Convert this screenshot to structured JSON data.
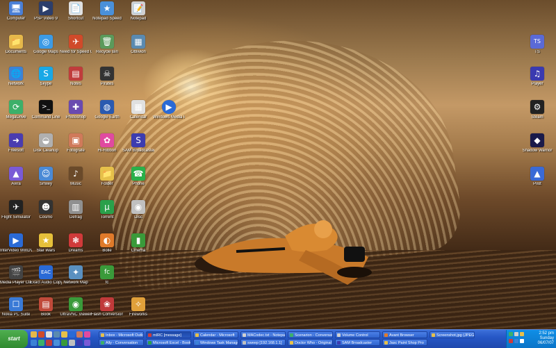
{
  "desktop": {
    "icons": [
      {
        "label": "Computer",
        "glyph": "🖥",
        "color": "#4a7fd6"
      },
      {
        "label": "PSP Video 9",
        "glyph": "▶",
        "color": "#2c3e6b"
      },
      {
        "label": "Shortcut",
        "glyph": "📄",
        "color": "#e0e0e0"
      },
      {
        "label": "Notepad Speed",
        "glyph": "★",
        "color": "#4a90d9"
      },
      {
        "label": "Notepad",
        "glyph": "📝",
        "color": "#d0d0d0"
      },
      {
        "label": "Documents",
        "glyph": "📁",
        "color": "#e6b84a"
      },
      {
        "label": "Google Maps",
        "glyph": "◎",
        "color": "#3c9be6"
      },
      {
        "label": "Need for Speed Underground",
        "glyph": "✈",
        "color": "#d04a2a"
      },
      {
        "label": "Recycle Bin",
        "glyph": "🗑",
        "color": "#5b9a5b"
      },
      {
        "label": "Oblivion",
        "glyph": "▦",
        "color": "#5a8ab0"
      },
      {
        "label": "Network",
        "glyph": "🌐",
        "color": "#3c82d6"
      },
      {
        "label": "Skype",
        "glyph": "S",
        "color": "#19a8e6"
      },
      {
        "label": "Notes",
        "glyph": "▤",
        "color": "#c03c3c"
      },
      {
        "label": "Pirates",
        "glyph": "☠",
        "color": "#333333"
      },
      {
        "label": "MegaDrive",
        "glyph": "⟳",
        "color": "#3cb06a"
      },
      {
        "label": "Command Line",
        "glyph": ">_",
        "color": "#111111"
      },
      {
        "label": "Photoshop",
        "glyph": "✚",
        "color": "#6a4ab0"
      },
      {
        "label": "Google Earth",
        "glyph": "◍",
        "color": "#2a5ab0"
      },
      {
        "label": "Calendar",
        "glyph": "▦",
        "color": "#e0e0e0"
      },
      {
        "label": "Windows Media Player",
        "glyph": "▶",
        "color": "#2a6ad6"
      },
      {
        "label": "Freesoft",
        "glyph": "➜",
        "color": "#4a3cb0"
      },
      {
        "label": "Disk Cleanup",
        "glyph": "◒",
        "color": "#b0b0b0"
      },
      {
        "label": "Fotografe",
        "glyph": "▣",
        "color": "#d07a5a"
      },
      {
        "label": "Hi-Ribbon",
        "glyph": "✿",
        "color": "#e04aa0"
      },
      {
        "label": "SAM Broadcaster",
        "glyph": "S",
        "color": "#3c3cb0"
      },
      {
        "label": "Avira",
        "glyph": "▲",
        "color": "#7a5ad6"
      },
      {
        "label": "Smiley",
        "glyph": "☺",
        "color": "#4a8ad6"
      },
      {
        "label": "Music",
        "glyph": "♪",
        "color": "#6a4a2a"
      },
      {
        "label": "Folder",
        "glyph": "📁",
        "color": "#e6c04a"
      },
      {
        "label": "Phone",
        "glyph": "☎",
        "color": "#2ab04a"
      },
      {
        "label": "Flight Simulator",
        "glyph": "✈",
        "color": "#222222"
      },
      {
        "label": "Cosmo",
        "glyph": "☻",
        "color": "#333333"
      },
      {
        "label": "Defrag",
        "glyph": "▥",
        "color": "#909090"
      },
      {
        "label": "Torrent",
        "glyph": "µ",
        "color": "#2aa04a"
      },
      {
        "label": "Disc",
        "glyph": "◉",
        "color": "#c0c0c0"
      },
      {
        "label": "InterVideo WinDVD",
        "glyph": "▶",
        "color": "#2a6ad6"
      },
      {
        "label": "Star Wars",
        "glyph": "★",
        "color": "#e6c03a"
      },
      {
        "label": "Dreams",
        "glyph": "❃",
        "color": "#d03a3a"
      },
      {
        "label": "Bolle",
        "glyph": "◐",
        "color": "#e07a2a"
      },
      {
        "label": "Cinema",
        "glyph": "▮",
        "color": "#3a9a3a"
      },
      {
        "label": "Media Player Classic",
        "glyph": "🎬",
        "color": "#444444"
      },
      {
        "label": "Exact Audio Copy",
        "glyph": "EAC",
        "color": "#2a6ad6"
      },
      {
        "label": "Network Map",
        "glyph": "✦",
        "color": "#5a90c0"
      },
      {
        "label": "fc",
        "glyph": "fc",
        "color": "#3a9a3a"
      },
      {
        "label": "Nokia PC Suite",
        "glyph": "☐",
        "color": "#3a7ad6"
      },
      {
        "label": "Book",
        "glyph": "▤",
        "color": "#c04a3a"
      },
      {
        "label": "UltraVNC Viewer",
        "glyph": "◉",
        "color": "#3a9a3a"
      },
      {
        "label": "Flash Conversion",
        "glyph": "❀",
        "color": "#c03a3a"
      },
      {
        "label": "Fireworks",
        "glyph": "✧",
        "color": "#e0a03a"
      },
      {
        "label": "TS",
        "glyph": "TS",
        "color": "#5a6ad6"
      },
      {
        "label": "Player",
        "glyph": "♫",
        "color": "#3a3ab0"
      },
      {
        "label": "Steam",
        "glyph": "⚙",
        "color": "#222222"
      },
      {
        "label": "Shadow Warrior",
        "glyph": "◆",
        "color": "#1a1a4a"
      },
      {
        "label": "Pilot",
        "glyph": "▲",
        "color": "#3a6ad6"
      }
    ]
  },
  "taskbar": {
    "start_label": "start",
    "quicklaunch_colors": [
      "#e6b84a",
      "#3c82d6",
      "#d04a2a",
      "#3cb06a",
      "#e0e0e0",
      "#c03c3c",
      "#5a8ab0",
      "#4a90d9",
      "#e6c04a",
      "#3a9a3a",
      "#2a6ad6",
      "#c0c0c0",
      "#d07a5a",
      "#3a3ab0",
      "#e04aa0",
      "#7a5ad6"
    ],
    "row1": [
      {
        "label": "Inbox - Microsoft Outlook",
        "color": "#e6c04a"
      },
      {
        "label": "mIRC [message]",
        "color": "#d03a3a"
      },
      {
        "label": "Calendar - Microsoft",
        "color": "#e6c04a"
      },
      {
        "label": "MACodec.txt - Notepad",
        "color": "#d0d0d0"
      },
      {
        "label": "Scenarion - Conversation",
        "color": "#3cb06a"
      },
      {
        "label": "Volume Control",
        "color": "#d0d0d0"
      },
      {
        "label": "Avant Browser",
        "color": "#e07a2a"
      },
      {
        "label": "Screenshot.jpg (JPEG)",
        "color": "#e6c04a"
      }
    ],
    "row2": [
      {
        "label": "Ally - Conversation",
        "color": "#3cb06a"
      },
      {
        "label": "Microsoft Excel - Book1",
        "color": "#2aa04a"
      },
      {
        "label": "Windows Task Manager",
        "color": "#3c82d6"
      },
      {
        "label": "sweep [192.168.1.1]",
        "color": "#c0c0c0"
      },
      {
        "label": "Doctor Who - Original",
        "color": "#e6c04a"
      },
      {
        "label": "SAM Broadcaster",
        "color": "#3c3cb0"
      },
      {
        "label": "Jasc Paint Shop Pro",
        "color": "#e6c04a"
      }
    ],
    "tray": {
      "time": "2:52 pm",
      "day": "Sunday",
      "date": "06/07/07",
      "icon_colors": [
        "#3cb06a",
        "#d0d0d0",
        "#e6c04a",
        "#d03a3a",
        "#3c82d6",
        "#ffffff"
      ]
    }
  }
}
